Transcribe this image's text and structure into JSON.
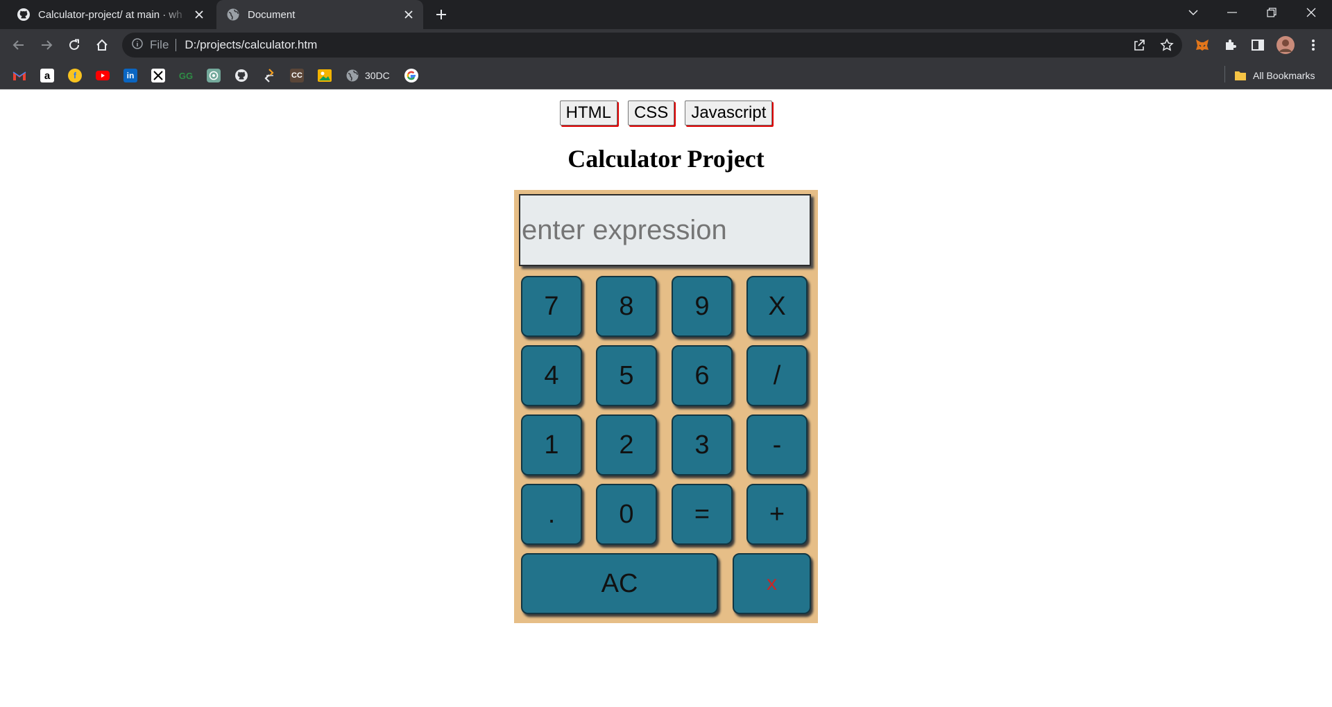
{
  "browser": {
    "tabs": [
      {
        "title": "Calculator-project/ at main · wh",
        "favicon": "github-icon",
        "active": false
      },
      {
        "title": "Document",
        "favicon": "globe-icon",
        "active": true
      }
    ],
    "address": {
      "scheme": "File",
      "url": "D:/projects/calculator.htm"
    },
    "bookmarks": [
      {
        "icon": "gmail-icon",
        "label": ""
      },
      {
        "icon": "amazon-icon",
        "label": ""
      },
      {
        "icon": "flipkart-icon",
        "label": ""
      },
      {
        "icon": "youtube-icon",
        "label": ""
      },
      {
        "icon": "linkedin-icon",
        "label": ""
      },
      {
        "icon": "x-icon",
        "label": ""
      },
      {
        "icon": "geeksforgeeks-icon",
        "label": ""
      },
      {
        "icon": "chatgpt-icon",
        "label": ""
      },
      {
        "icon": "github-icon",
        "label": ""
      },
      {
        "icon": "code-icon",
        "label": ""
      },
      {
        "icon": "cc-icon",
        "label": ""
      },
      {
        "icon": "photos-icon",
        "label": ""
      },
      {
        "icon": "globe-icon",
        "label": "30DC"
      },
      {
        "icon": "google-icon",
        "label": ""
      }
    ],
    "all_bookmarks": "All Bookmarks"
  },
  "page": {
    "nav_buttons": [
      "HTML",
      "CSS",
      "Javascript"
    ],
    "title": "Calculator Project",
    "display_placeholder": "enter expression",
    "keys": {
      "row1": [
        "7",
        "8",
        "9",
        "X"
      ],
      "row2": [
        "4",
        "5",
        "6",
        "/"
      ],
      "row3": [
        "1",
        "2",
        "3",
        "-"
      ],
      "row4": [
        ".",
        "0",
        "=",
        "+"
      ],
      "clear": "AC",
      "delete": "x"
    }
  },
  "colors": {
    "calc_background": "#e6be87",
    "key_background": "#22738b",
    "delete_key_text": "#c62828",
    "nav_button_shadow": "#e00000"
  }
}
